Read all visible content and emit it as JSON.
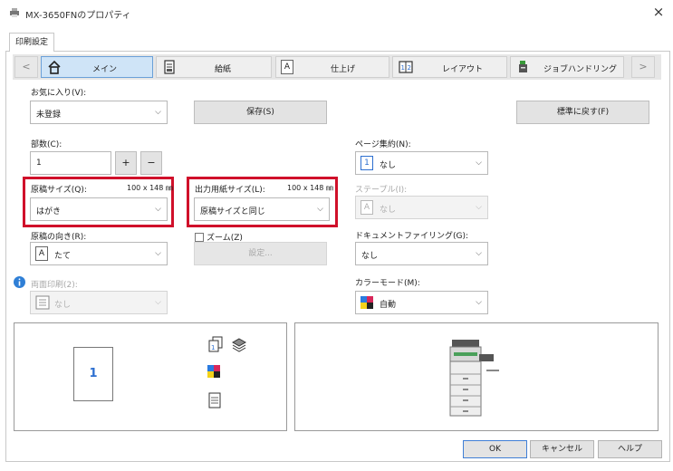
{
  "window": {
    "title": "MX-3650FNのプロパティ",
    "close_glyph": "×"
  },
  "tab": {
    "label": "印刷設定"
  },
  "nav": {
    "prev": "<",
    "next": ">",
    "items": [
      {
        "label": "メイン",
        "icon": "home-icon"
      },
      {
        "label": "給紙",
        "icon": "paper-tray-icon"
      },
      {
        "label": "仕上げ",
        "icon": "finishing-icon"
      },
      {
        "label": "レイアウト",
        "icon": "layout-icon"
      },
      {
        "label": "ジョブハンドリング",
        "icon": "job-handling-icon"
      }
    ]
  },
  "favorites": {
    "label": "お気に入り(V):",
    "value": "未登録",
    "save_button": "保存(S)",
    "reset_button": "標準に戻す(F)"
  },
  "copies": {
    "label": "部数(C):",
    "value": "1",
    "plus": "+",
    "minus": "−"
  },
  "original_size": {
    "label": "原稿サイズ(Q):",
    "dims": "100 x 148 ㎜",
    "value": "はがき"
  },
  "output_size": {
    "label": "出力用紙サイズ(L):",
    "dims": "100 x 148 ㎜",
    "value": "原稿サイズと同じ"
  },
  "orientation": {
    "label": "原稿の向き(R):",
    "value": "たて"
  },
  "zoom": {
    "label": "ズーム(Z)",
    "settings_button": "設定..."
  },
  "duplex": {
    "label": "両面印刷(2):",
    "value": "なし"
  },
  "nup": {
    "label": "ページ集約(N):",
    "value": "なし",
    "icon_text": "1"
  },
  "staple": {
    "label": "ステープル(I):",
    "value": "なし"
  },
  "doc_filing": {
    "label": "ドキュメントファイリング(G):",
    "value": "なし"
  },
  "color_mode": {
    "label": "カラーモード(M):",
    "value": "自動"
  },
  "preview": {
    "page_number": "1"
  },
  "footer": {
    "ok": "OK",
    "cancel": "キャンセル",
    "help": "ヘルプ"
  },
  "colors": {
    "highlight_red": "#d0102a",
    "active_tab_bg": "#cfe4f7",
    "info_blue": "#2f7fd6",
    "preview_page_number": "#2d6fd0"
  }
}
